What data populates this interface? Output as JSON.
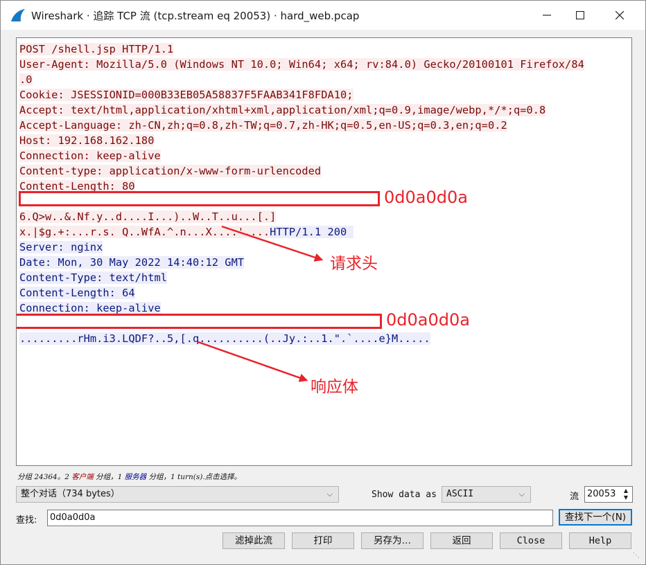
{
  "window": {
    "title": "Wireshark · 追踪 TCP 流 (tcp.stream eq 20053) · hard_web.pcap"
  },
  "stream_lines": [
    {
      "text": "POST /shell.jsp HTTP/1.1",
      "side": "client"
    },
    {
      "text": "User-Agent: Mozilla/5.0 (Windows NT 10.0; Win64; x64; rv:84.0) Gecko/20100101 Firefox/84",
      "side": "client"
    },
    {
      "text": ".0",
      "side": "client"
    },
    {
      "text": "Cookie: JSESSIONID=000B33EB05A58837F5FAAB341F8FDA10;",
      "side": "client"
    },
    {
      "text": "Accept: text/html,application/xhtml+xml,application/xml;q=0.9,image/webp,*/*;q=0.8",
      "side": "client"
    },
    {
      "text": "Accept-Language: zh-CN,zh;q=0.8,zh-TW;q=0.7,zh-HK;q=0.5,en-US;q=0.3,en;q=0.2",
      "side": "client"
    },
    {
      "text": "Host: 192.168.162.180",
      "side": "client"
    },
    {
      "text": "Connection: keep-alive",
      "side": "client"
    },
    {
      "text": "Content-type: application/x-www-form-urlencoded",
      "side": "client"
    },
    {
      "text": "Content-Length: 80",
      "side": "client"
    },
    {
      "text": "",
      "side": "client"
    },
    {
      "text": "6.Q>w..&.Nf.y..d....I...)..W..T..u...[.]",
      "side": "client"
    },
    {
      "text": "x.|$g.+:...r.s. Q..WfA.^.n...X....'....",
      "side": "client",
      "tail": "HTTP/1.1 200 "
    },
    {
      "text": "Server: nginx",
      "side": "server"
    },
    {
      "text": "Date: Mon, 30 May 2022 14:40:12 GMT",
      "side": "server"
    },
    {
      "text": "Content-Type: text/html",
      "side": "server"
    },
    {
      "text": "Content-Length: 64",
      "side": "server"
    },
    {
      "text": "Connection: keep-alive",
      "side": "server"
    },
    {
      "text": "",
      "side": "server"
    },
    {
      "text": ".........rHm.i3.LQDF?..5,[.q..........(..Jy.:..1.\".`....e}M.....",
      "side": "server"
    }
  ],
  "annotations": {
    "crlf_1": "0d0a0d0a",
    "crlf_2": "0d0a0d0a",
    "request_header": "请求头",
    "response_body": "响应体"
  },
  "summary": {
    "prefix": "分组 24364。2 ",
    "client": "客户端",
    "mid": " 分组，1 ",
    "server": "服务器",
    "suffix": " 分组，1 turn(s).点击选择。"
  },
  "controls": {
    "conversation_select": "整个对话（734 bytes）",
    "show_data_label": "Show data as",
    "show_data_value": "ASCII",
    "stream_label": "流",
    "stream_value": "20053",
    "find_label": "查找:",
    "find_value": "0d0a0d0a",
    "find_next": "查找下一个(N)"
  },
  "buttons": {
    "filter_out": "滤掉此流",
    "print": "打印",
    "save_as": "另存为…",
    "back": "返回",
    "close": "Close",
    "help": "Help"
  },
  "colors": {
    "client_text": "#7a0a0a",
    "client_bg": "#fbeded",
    "server_text": "#0a1a7a",
    "server_bg": "#ededfb",
    "annotation_red": "#e8232a"
  }
}
